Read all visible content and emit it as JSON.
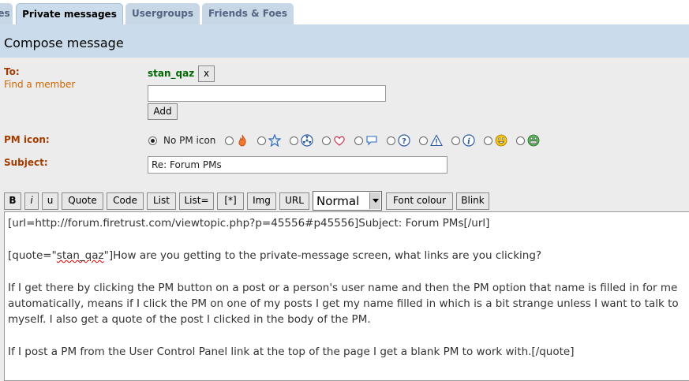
{
  "tabs": [
    {
      "label": "es"
    },
    {
      "label": "Private messages",
      "active": true
    },
    {
      "label": "Usergroups"
    },
    {
      "label": "Friends & Foes"
    }
  ],
  "header": {
    "title": "Compose message"
  },
  "to": {
    "label": "To:",
    "find_member": "Find a member",
    "recipient": "stan_qaz",
    "remove_label": "x",
    "input_value": "",
    "add_label": "Add"
  },
  "pm_icon": {
    "label": "PM icon:",
    "no_icon_label": "No PM icon",
    "icons": [
      "fire-icon",
      "star-icon",
      "radioactive-icon",
      "heart-icon",
      "speech-bubble-icon",
      "question-icon",
      "warning-icon",
      "info-icon",
      "mrgreen-smiley-icon",
      "grin-smiley-icon"
    ]
  },
  "subject": {
    "label": "Subject:",
    "value": "Re: Forum PMs"
  },
  "toolbar": {
    "buttons": [
      "B",
      "i",
      "u",
      "Quote",
      "Code",
      "List",
      "List=",
      "[*]",
      "Img",
      "URL"
    ],
    "font_size": "Normal",
    "font_colour": "Font colour",
    "blink": "Blink"
  },
  "message": {
    "line1": "[url=http://forum.firetrust.com/viewtopic.php?p=45556#p45556]Subject: Forum PMs[/url]",
    "line2_a": "[quote=\"",
    "line2_b": "stan_qaz",
    "line2_c": "\"]How are you getting to the private-message screen, what links are you clicking?",
    "line3": "If I get there by clicking the PM button on a post or a person's user name and then the PM option that name is filled in for me",
    "line4": "automatically, means if I click the PM on one of my posts I get my name filled in which is a bit strange unless I want to talk to",
    "line5": "myself. I also get a quote of the post I clicked in the body of the PM.",
    "line6": "If I post a PM from the User Control Panel link at the top of the page I get a blank PM to work with.[/quote]"
  },
  "colors": {
    "tab": "#c7d7e5",
    "header": "#cadceb",
    "panel": "#ececec",
    "label": "#a33c00",
    "link": "#cc6600",
    "recipient": "#006600"
  }
}
